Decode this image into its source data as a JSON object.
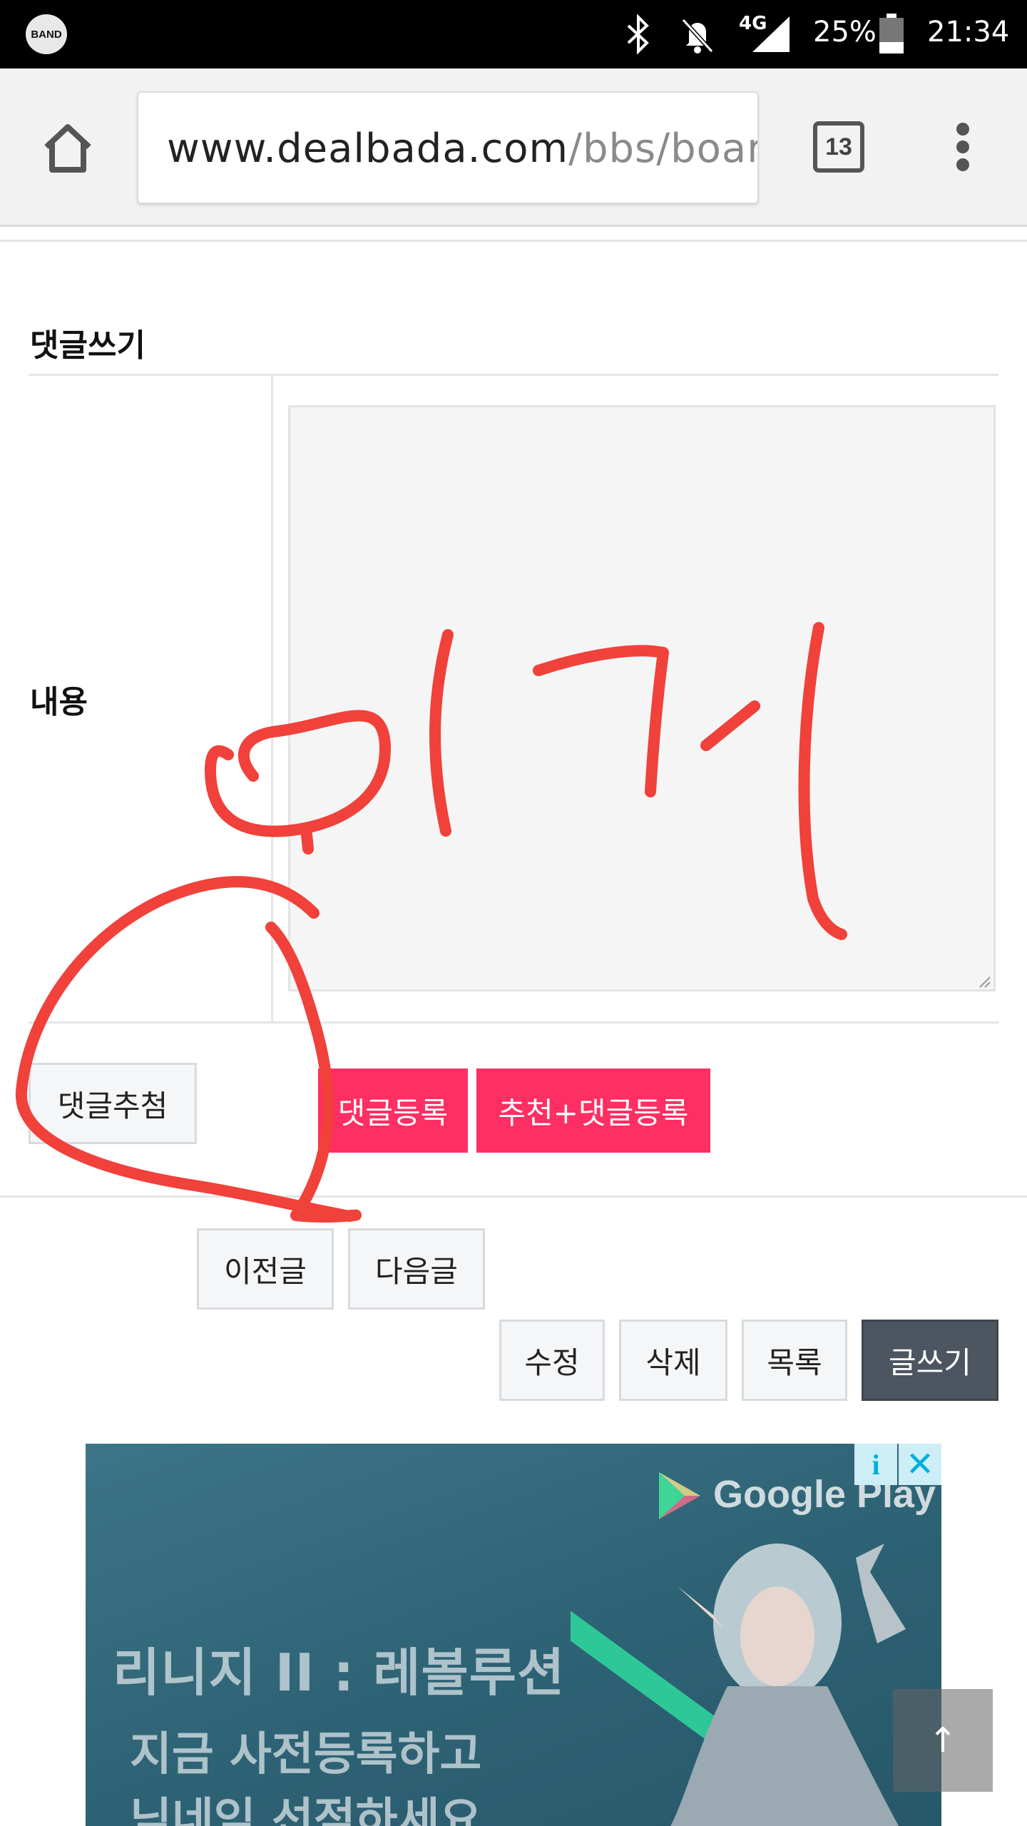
{
  "status_bar": {
    "app_badge": "BAND",
    "network": "4G",
    "battery": "25%",
    "time": "21:34"
  },
  "browser": {
    "url_domain": "www.dealbada.com",
    "url_path": "/bbs/board",
    "tab_count": "13"
  },
  "comment_form": {
    "title": "댓글쓰기",
    "content_label": "내용",
    "content_value": "",
    "lottery_button": "댓글추첨",
    "submit_button": "댓글등록",
    "recommend_submit_button": "추천+댓글등록"
  },
  "post_nav": {
    "prev_button": "이전글",
    "next_button": "다음글"
  },
  "post_actions": {
    "edit_button": "수정",
    "delete_button": "삭제",
    "list_button": "목록",
    "write_button": "글쓰기"
  },
  "ad": {
    "store": "Google Play",
    "headline": "리니지 II : 레볼루션",
    "sub_line1": "지금 사전등록하고",
    "sub_line2": "닉네임 선점하세요",
    "info_icon": "i",
    "close_icon": "✕"
  },
  "scroll_top_glyph": "↑",
  "annotation_text": "이거",
  "colors": {
    "accent_pink": "#ff2e63",
    "dark_button": "#4d5560",
    "annotation_red": "#f0413a"
  }
}
